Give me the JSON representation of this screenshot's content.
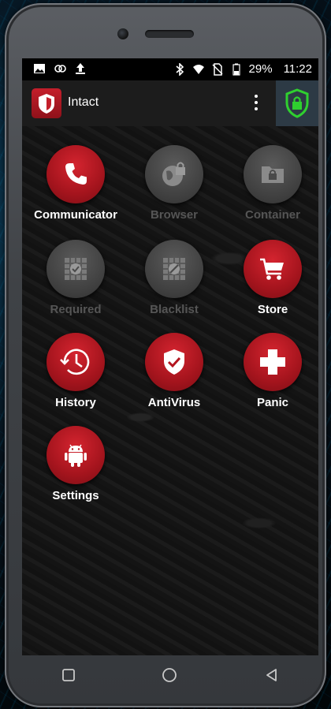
{
  "status_bar": {
    "battery_percent": "29%",
    "time": "11:22",
    "icons": [
      "image-icon",
      "sync-icon",
      "upload-icon",
      "bluetooth-icon",
      "wifi-icon",
      "no-sim-icon",
      "battery-icon"
    ]
  },
  "app_bar": {
    "title": "Intact",
    "menu_icon": "more-vert-icon",
    "shield_icon": "lock-shield-icon",
    "shield_color": "#2fd02f"
  },
  "apps": [
    {
      "label": "Communicator",
      "icon": "phone-icon",
      "enabled": true
    },
    {
      "label": "Browser",
      "icon": "globe-lock-icon",
      "enabled": false
    },
    {
      "label": "Container",
      "icon": "folder-lock-icon",
      "enabled": false
    },
    {
      "label": "Required",
      "icon": "grid-check-icon",
      "enabled": false
    },
    {
      "label": "Blacklist",
      "icon": "grid-block-icon",
      "enabled": false
    },
    {
      "label": "Store",
      "icon": "cart-icon",
      "enabled": true
    },
    {
      "label": "History",
      "icon": "history-icon",
      "enabled": true
    },
    {
      "label": "AntiVirus",
      "icon": "shield-check-icon",
      "enabled": true
    },
    {
      "label": "Panic",
      "icon": "plus-icon",
      "enabled": true
    },
    {
      "label": "Settings",
      "icon": "android-icon",
      "enabled": true
    }
  ],
  "nav_bar": {
    "icons": [
      "recents-icon",
      "home-icon",
      "back-icon"
    ]
  },
  "colors": {
    "accent_red": "#c41f2b",
    "disabled_gray": "#4a4a4a"
  }
}
